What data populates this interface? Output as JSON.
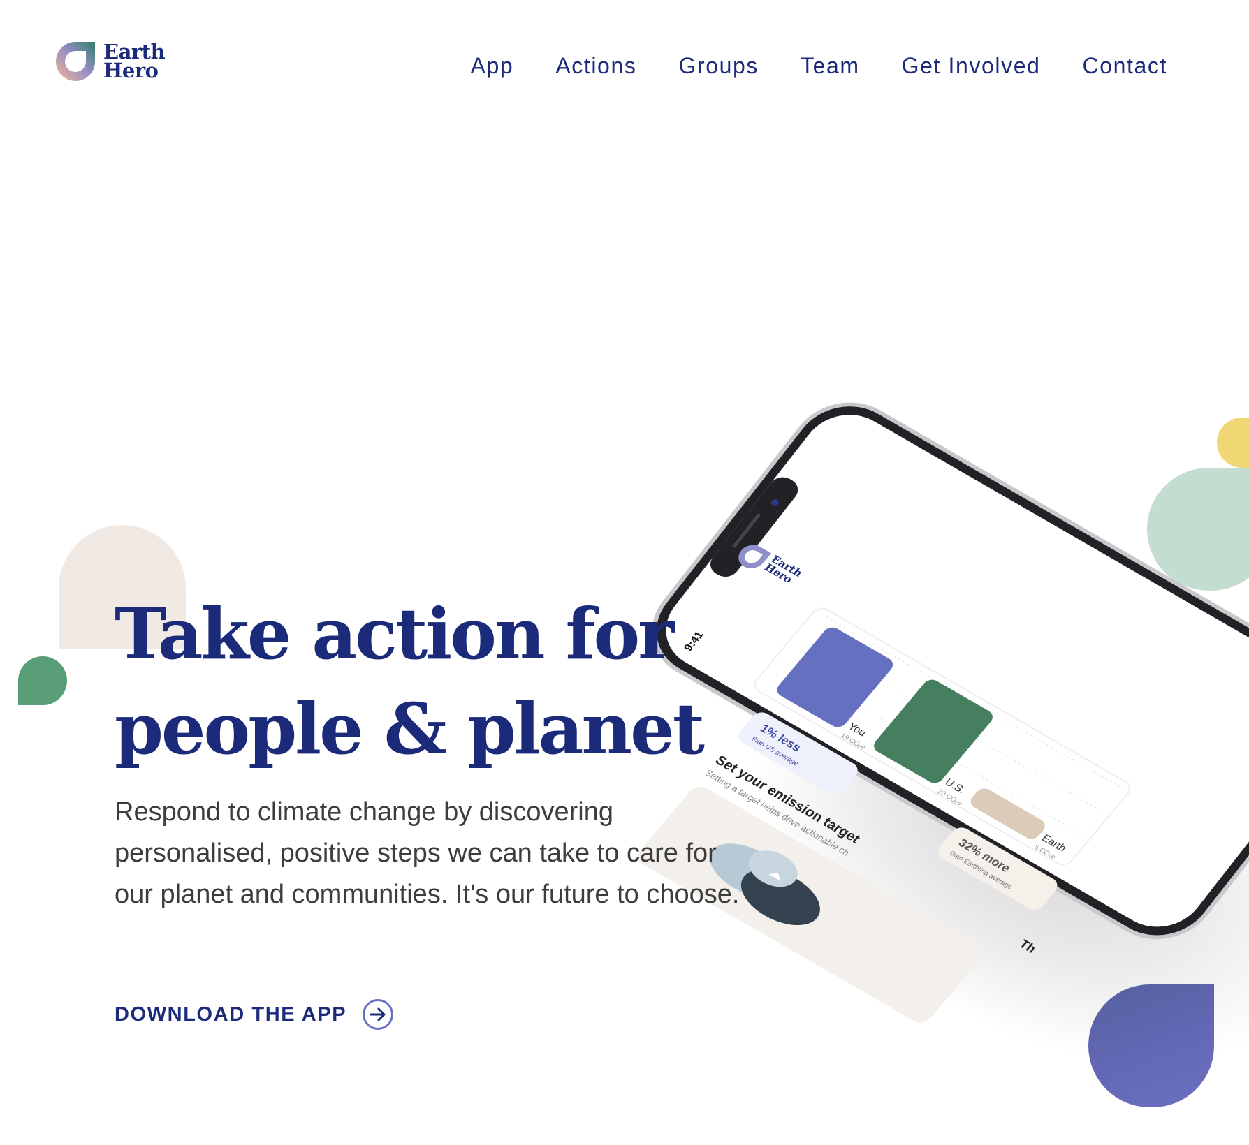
{
  "brand": {
    "name_line1": "Earth",
    "name_line2": "Hero"
  },
  "nav": {
    "items": [
      "App",
      "Actions",
      "Groups",
      "Team",
      "Get Involved",
      "Contact"
    ]
  },
  "hero": {
    "title_line1": "Take action for",
    "title_line2": "people & planet",
    "description": "Respond to climate change by discovering personalised, positive steps we can take to care for our planet and communities. It's our future to choose.",
    "cta_label": "DOWNLOAD THE APP"
  },
  "phone": {
    "status_time": "9:41",
    "app_logo_line1": "Earth",
    "app_logo_line2": "Hero",
    "chart": {
      "bars": [
        {
          "label": "You",
          "sub": "19 CO₂e",
          "value": 19
        },
        {
          "label": "U.S.",
          "sub": "20 CO₂e",
          "value": 20
        },
        {
          "label": "Earth",
          "sub": "5 CO₂e",
          "value": 5
        }
      ],
      "badge_less": "1% less",
      "badge_less_sub": "than US average",
      "badge_more": "32% more",
      "badge_more_sub": "than Earthling average"
    },
    "target_title": "Set your emission target",
    "target_sub": "Setting a target helps drive actionable ch",
    "cut_off_text": "Th"
  },
  "colors": {
    "brand_navy": "#1c2a7a",
    "bar_you": "#6570c0",
    "bar_us": "#467f60",
    "bar_earth": "#dccbb9",
    "accent_yellow": "#f0d774",
    "accent_mint": "#c3ded0",
    "accent_green": "#5a9e78",
    "accent_beige": "#f1e9e3",
    "accent_indigo": "#6469b8"
  },
  "icons": {
    "logo": "earth-hero-logo-icon",
    "cta": "arrow-circle-right-icon"
  }
}
